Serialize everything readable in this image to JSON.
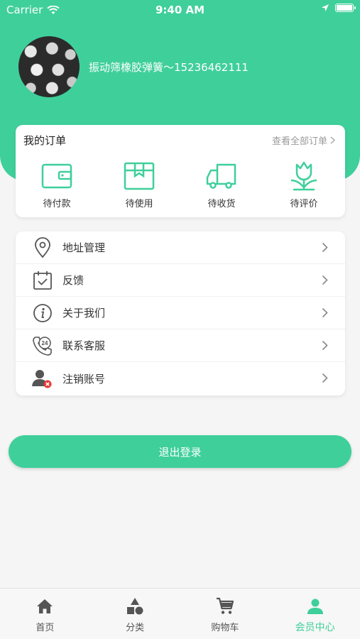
{
  "status": {
    "carrier": "Carrier",
    "time": "9:40 AM"
  },
  "profile": {
    "name": "振动筛橡胶弹簧～15236462111"
  },
  "orders": {
    "title": "我的订单",
    "view_all": "查看全部订单",
    "items": [
      {
        "label": "待付款",
        "icon": "wallet-icon"
      },
      {
        "label": "待使用",
        "icon": "box-icon"
      },
      {
        "label": "待收货",
        "icon": "truck-icon"
      },
      {
        "label": "待评价",
        "icon": "flower-icon"
      }
    ]
  },
  "menu": [
    {
      "label": "地址管理",
      "icon": "location-pin-icon"
    },
    {
      "label": "反馈",
      "icon": "calendar-check-icon"
    },
    {
      "label": "关于我们",
      "icon": "info-icon"
    },
    {
      "label": "联系客服",
      "icon": "phone-24-icon"
    },
    {
      "label": "注销账号",
      "icon": "user-remove-icon"
    }
  ],
  "logout_label": "退出登录",
  "tabs": [
    {
      "label": "首页",
      "icon": "home-icon",
      "active": false
    },
    {
      "label": "分类",
      "icon": "shapes-icon",
      "active": false
    },
    {
      "label": "购物车",
      "icon": "cart-icon",
      "active": false
    },
    {
      "label": "会员中心",
      "icon": "user-icon",
      "active": true
    }
  ],
  "colors": {
    "accent": "#3fcf9b",
    "background": "#f5f5f5",
    "text": "#333333",
    "muted": "#9a9a9a"
  }
}
